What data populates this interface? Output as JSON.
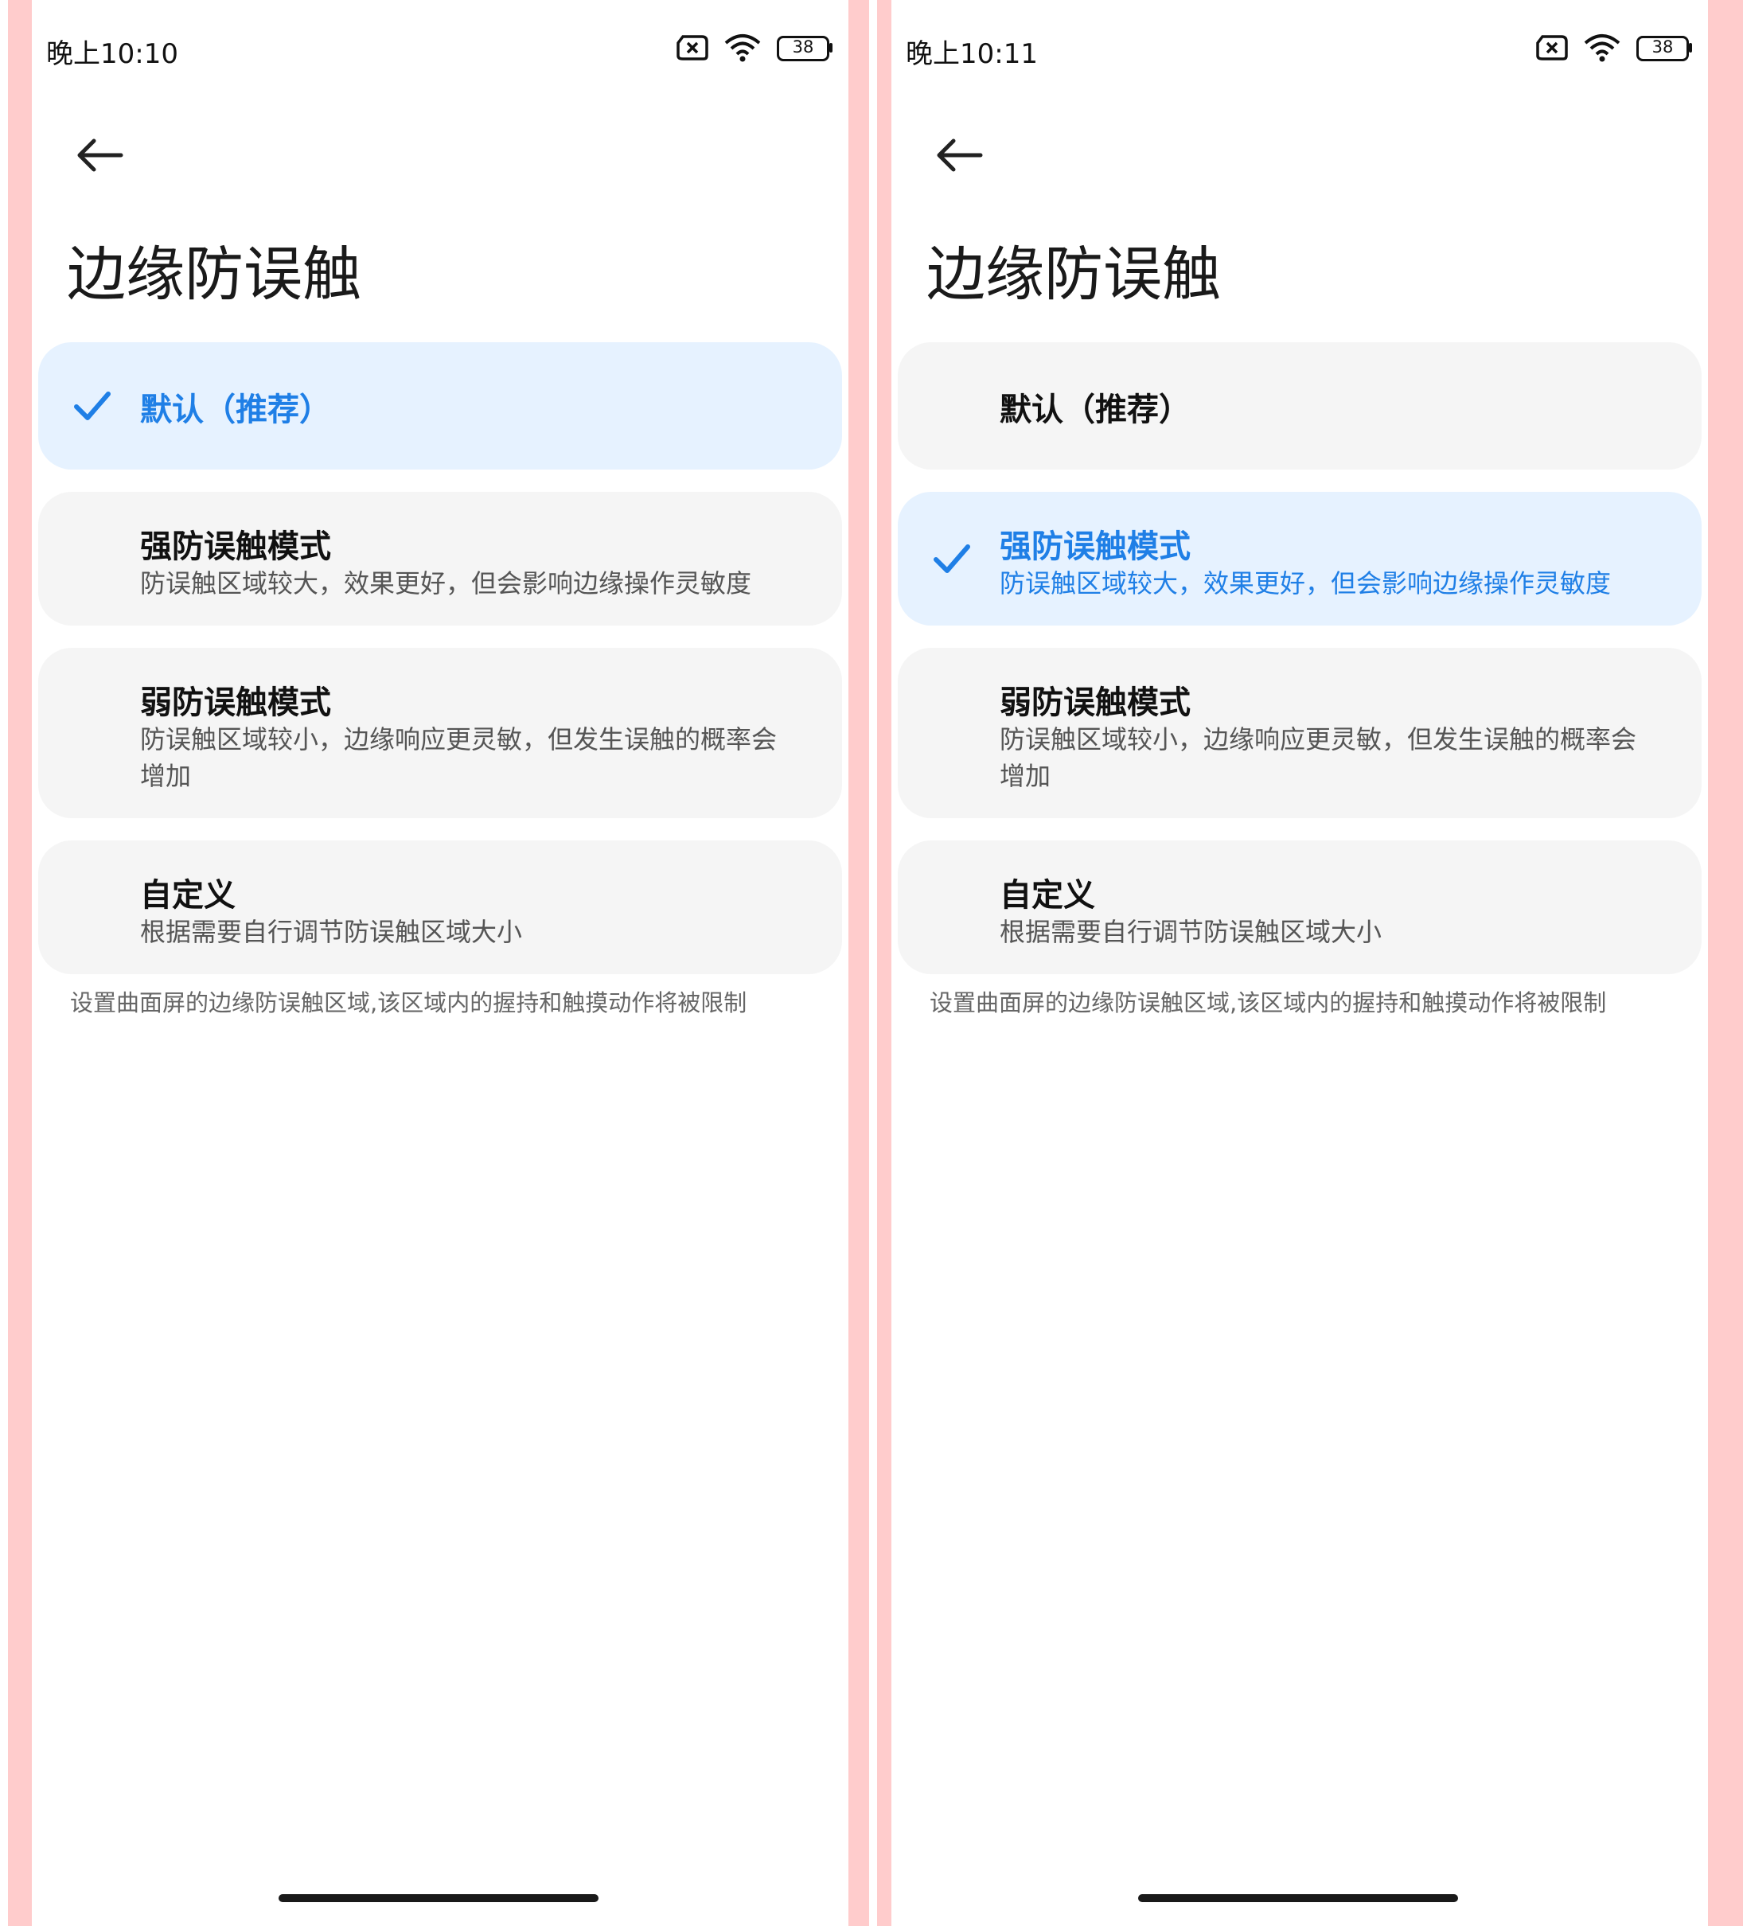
{
  "screens": [
    {
      "status": {
        "time": "晚上10:10",
        "battery": "38"
      },
      "title": "边缘防误触",
      "options": [
        {
          "title": "默认（推荐）",
          "desc": "",
          "selected": true
        },
        {
          "title": "强防误触模式",
          "desc": "防误触区域较大，效果更好，但会影响边缘操作灵敏度",
          "selected": false
        },
        {
          "title": "弱防误触模式",
          "desc": "防误触区域较小，边缘响应更灵敏，但发生误触的概率会增加",
          "selected": false
        },
        {
          "title": "自定义",
          "desc": "根据需要自行调节防误触区域大小",
          "selected": false
        }
      ],
      "footnote": "设置曲面屏的边缘防误触区域,该区域内的握持和触摸动作将被限制"
    },
    {
      "status": {
        "time": "晚上10:11",
        "battery": "38"
      },
      "title": "边缘防误触",
      "options": [
        {
          "title": "默认（推荐）",
          "desc": "",
          "selected": false
        },
        {
          "title": "强防误触模式",
          "desc": "防误触区域较大，效果更好，但会影响边缘操作灵敏度",
          "selected": true
        },
        {
          "title": "弱防误触模式",
          "desc": "防误触区域较小，边缘响应更灵敏，但发生误触的概率会增加",
          "selected": false
        },
        {
          "title": "自定义",
          "desc": "根据需要自行调节防误触区域大小",
          "selected": false
        }
      ],
      "footnote": "设置曲面屏的边缘防误触区域,该区域内的握持和触摸动作将被限制"
    }
  ],
  "icons": {
    "back": "back-arrow-icon",
    "sim": "no-sim-icon",
    "wifi": "wifi-icon",
    "battery": "battery-icon",
    "check": "checkmark-icon"
  },
  "colors": {
    "accent": "#1f7fe6",
    "selected_bg": "#e6f2ff",
    "card_bg": "#f5f5f5",
    "side_bar": "#ffcccc"
  }
}
